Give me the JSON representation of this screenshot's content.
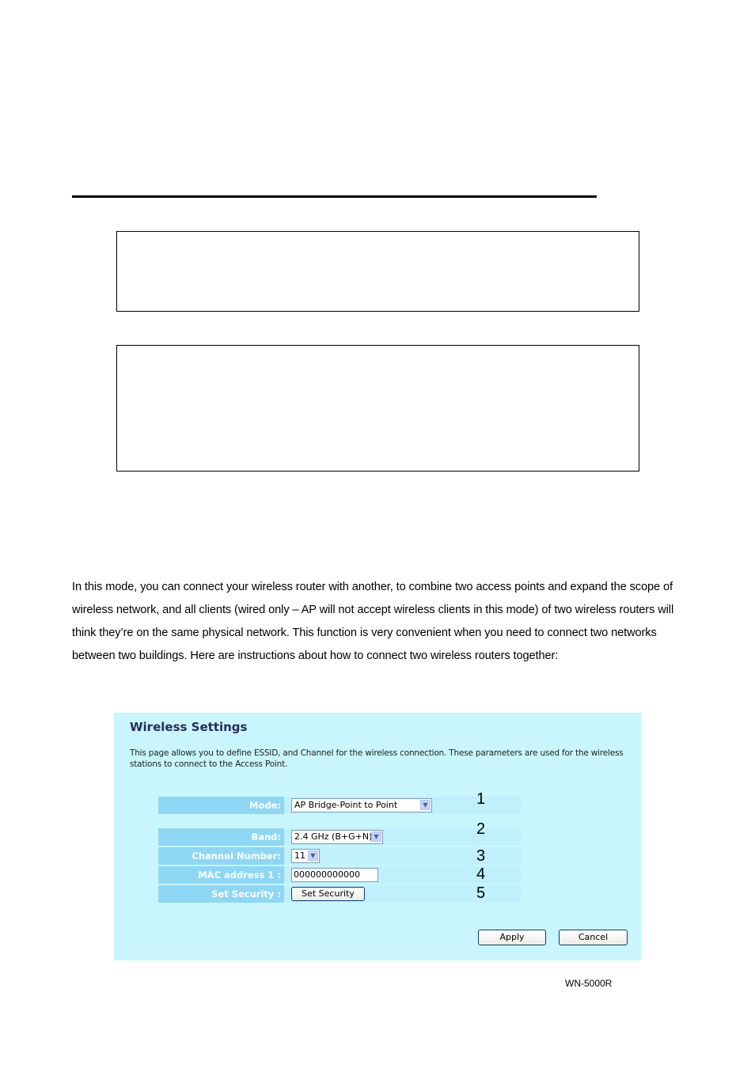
{
  "document": {
    "paragraph": "In this mode, you can connect your wireless router with another, to combine two access points and expand the scope of wireless network, and all clients (wired only – AP will not accept wireless clients in this mode) of two wireless routers will think they’re on the same physical network. This function is very convenient when you need to connect two networks between two buildings. Here are instructions about how to connect two wireless routers together:",
    "footer": "WN-5000R"
  },
  "panel": {
    "title": "Wireless Settings",
    "description": "This page allows you to define ESSID, and Channel for the wireless connection. These parameters are used for the wireless stations to connect to the Access Point.",
    "rows": [
      {
        "label": "Mode:",
        "value": "AP Bridge-Point to Point",
        "type": "select",
        "marker": "1"
      },
      {
        "label": "Band:",
        "value": "2.4 GHz (B+G+N)",
        "type": "select",
        "marker": "2"
      },
      {
        "label": "Channel Number:",
        "value": "11",
        "type": "select",
        "marker": "3"
      },
      {
        "label": "MAC address 1 :",
        "value": "000000000000",
        "type": "text",
        "marker": "4"
      },
      {
        "label": "Set Security :",
        "value": "Set Security",
        "type": "button",
        "marker": "5"
      }
    ],
    "apply_label": "Apply",
    "cancel_label": "Cancel"
  },
  "colors": {
    "panel_bg": "#c8f6fc",
    "label_bg": "#8dd7f4",
    "row_bg": "#bff0fb",
    "title_color": "#2a2a5a"
  }
}
